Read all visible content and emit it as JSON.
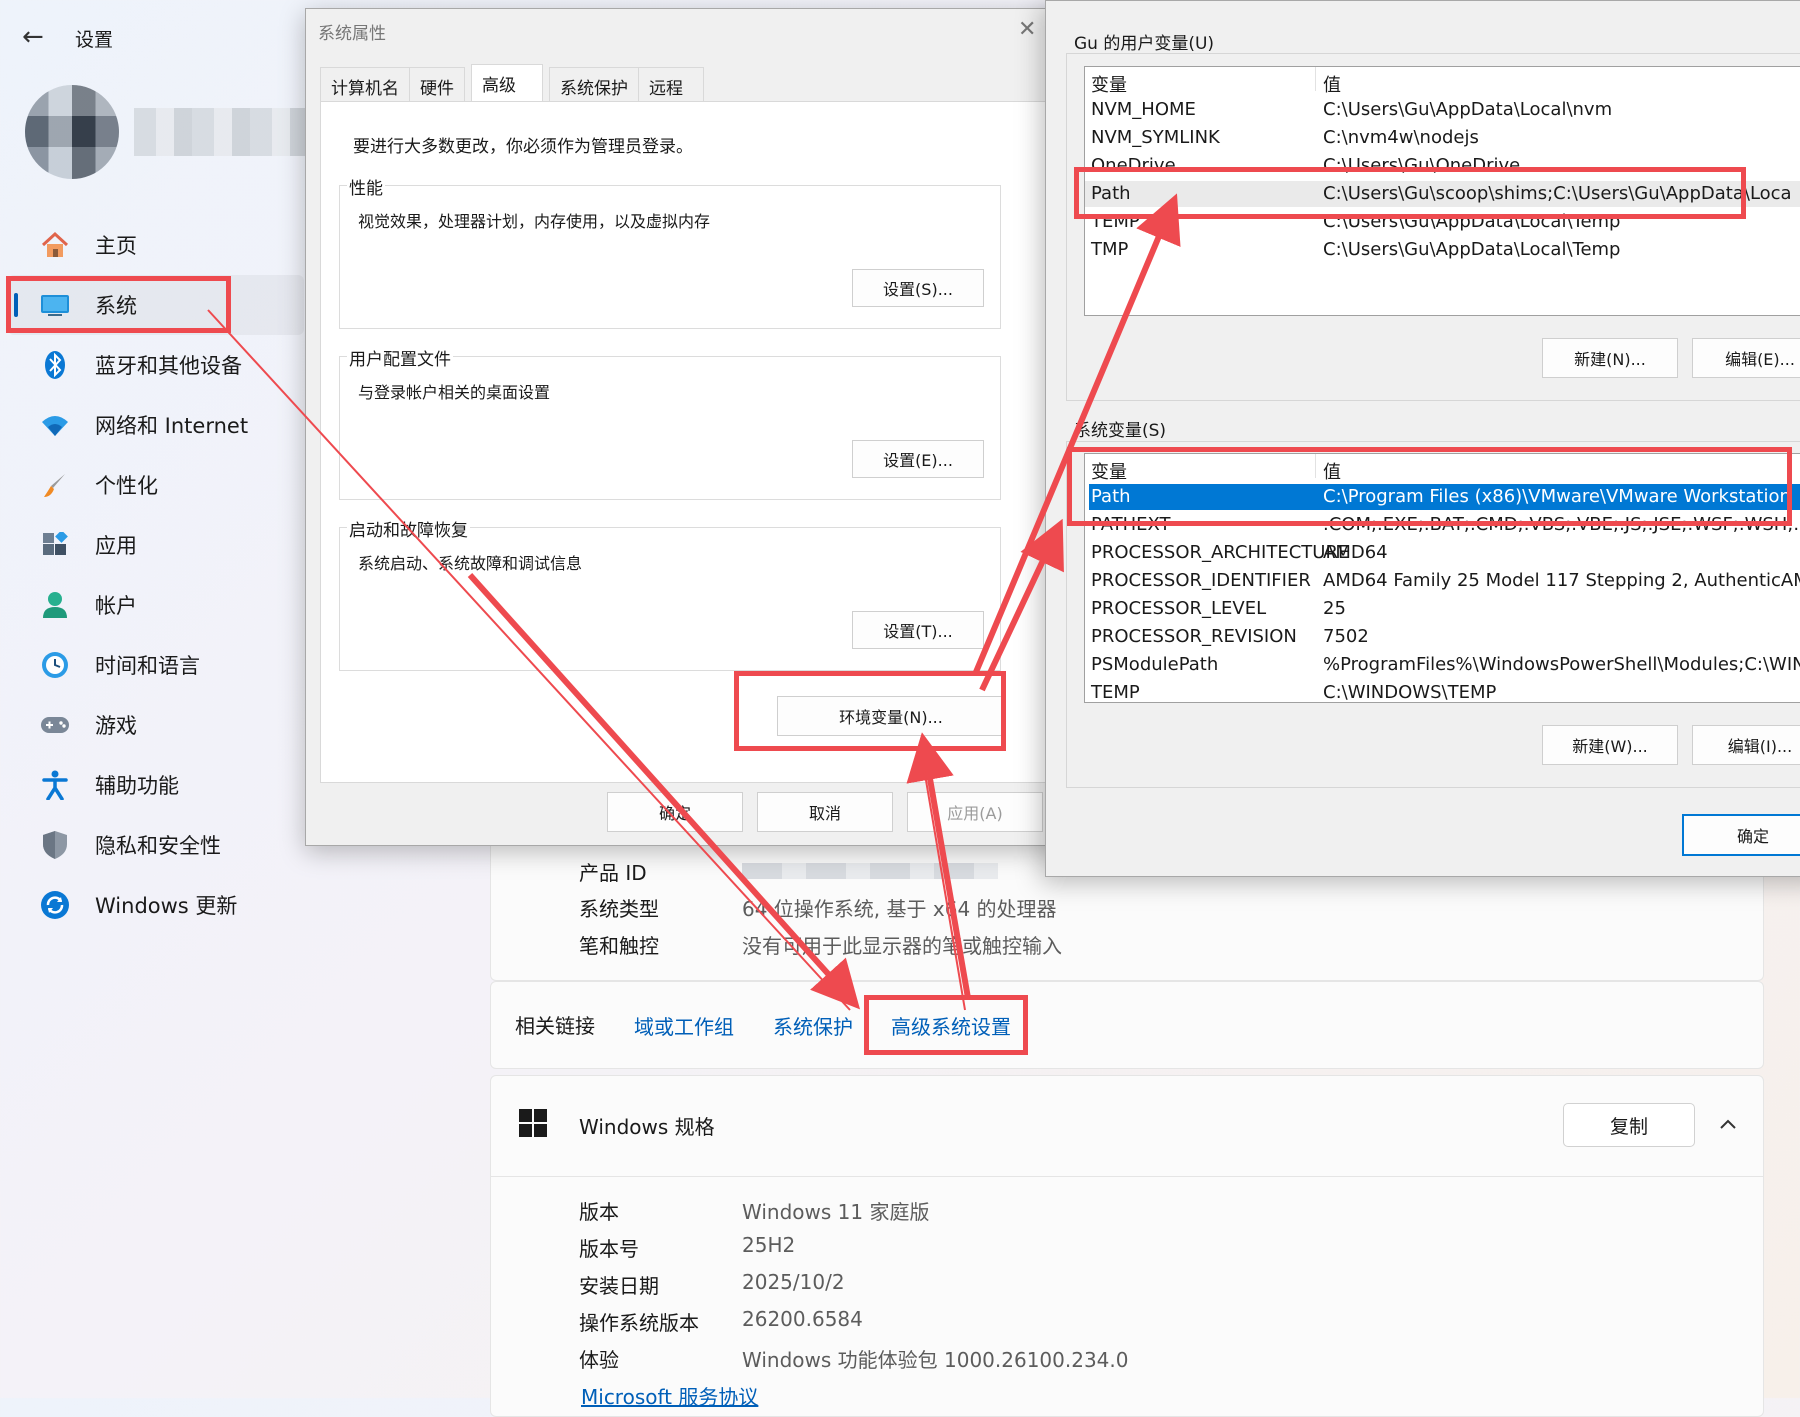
{
  "settings": {
    "title": "设置",
    "nav": [
      {
        "label": "主页",
        "icon": "home-icon"
      },
      {
        "label": "系统",
        "icon": "system-icon",
        "active": true
      },
      {
        "label": "蓝牙和其他设备",
        "icon": "bluetooth-icon"
      },
      {
        "label": "网络和 Internet",
        "icon": "wifi-icon"
      },
      {
        "label": "个性化",
        "icon": "brush-icon"
      },
      {
        "label": "应用",
        "icon": "apps-icon"
      },
      {
        "label": "帐户",
        "icon": "account-icon"
      },
      {
        "label": "时间和语言",
        "icon": "clock-globe-icon"
      },
      {
        "label": "游戏",
        "icon": "gamepad-icon"
      },
      {
        "label": "辅助功能",
        "icon": "accessibility-icon"
      },
      {
        "label": "隐私和安全性",
        "icon": "shield-icon"
      },
      {
        "label": "Windows 更新",
        "icon": "update-icon"
      }
    ],
    "device_specs": [
      {
        "key": "产品 ID",
        "value": ""
      },
      {
        "key": "系统类型",
        "value": "64 位操作系统, 基于 x64 的处理器"
      },
      {
        "key": "笔和触控",
        "value": "没有可用于此显示器的笔或触控输入"
      }
    ],
    "related": {
      "label": "相关链接",
      "links": [
        "域或工作组",
        "系统保护",
        "高级系统设置"
      ]
    },
    "windows_specs": {
      "title": "Windows 规格",
      "copy": "复制",
      "rows": [
        {
          "key": "版本",
          "value": "Windows 11 家庭版"
        },
        {
          "key": "版本号",
          "value": "25H2"
        },
        {
          "key": "安装日期",
          "value": "2025/10/2"
        },
        {
          "key": "操作系统版本",
          "value": "26200.6584"
        },
        {
          "key": "体验",
          "value": "Windows 功能体验包 1000.26100.234.0"
        }
      ],
      "link": "Microsoft 服务协议"
    }
  },
  "sysprops": {
    "title": "系统属性",
    "tabs": [
      "计算机名",
      "硬件",
      "高级",
      "系统保护",
      "远程"
    ],
    "notice": "要进行大多数更改，你必须作为管理员登录。",
    "groups": [
      {
        "title": "性能",
        "desc": "视觉效果，处理器计划，内存使用，以及虚拟内存",
        "button": "设置(S)..."
      },
      {
        "title": "用户配置文件",
        "desc": "与登录帐户相关的桌面设置",
        "button": "设置(E)..."
      },
      {
        "title": "启动和故障恢复",
        "desc": "系统启动、系统故障和调试信息",
        "button": "设置(T)..."
      }
    ],
    "env_button": "环境变量(N)...",
    "ok": "确定",
    "cancel": "取消",
    "apply": "应用(A)"
  },
  "envvars": {
    "user_title": "Gu 的用户变量(U)",
    "col_var": "变量",
    "col_val": "值",
    "user_vars": [
      {
        "name": "NVM_HOME",
        "value": "C:\\Users\\Gu\\AppData\\Local\\nvm"
      },
      {
        "name": "NVM_SYMLINK",
        "value": "C:\\nvm4w\\nodejs"
      },
      {
        "name": "OneDrive",
        "value": "C:\\Users\\Gu\\OneDrive"
      },
      {
        "name": "Path",
        "value": "C:\\Users\\Gu\\scoop\\shims;C:\\Users\\Gu\\AppData\\Loca"
      },
      {
        "name": "TEMP",
        "value": "C:\\Users\\Gu\\AppData\\Local\\Temp"
      },
      {
        "name": "TMP",
        "value": "C:\\Users\\Gu\\AppData\\Local\\Temp"
      }
    ],
    "user_new": "新建(N)...",
    "user_edit": "编辑(E)...",
    "sys_title": "系统变量(S)",
    "sys_vars": [
      {
        "name": "Path",
        "value": "C:\\Program Files (x86)\\VMware\\VMware Workstation"
      },
      {
        "name": "PATHEXT",
        "value": ".COM;.EXE;.BAT;.CMD;.VBS;.VBE;.JS;.JSE;.WSF;.WSH;.MSC"
      },
      {
        "name": "PROCESSOR_ARCHITECTURE",
        "value": "AMD64"
      },
      {
        "name": "PROCESSOR_IDENTIFIER",
        "value": "AMD64 Family 25 Model 117 Stepping 2, AuthenticAMD"
      },
      {
        "name": "PROCESSOR_LEVEL",
        "value": "25"
      },
      {
        "name": "PROCESSOR_REVISION",
        "value": "7502"
      },
      {
        "name": "PSModulePath",
        "value": "%ProgramFiles%\\WindowsPowerShell\\Modules;C:\\WIN"
      },
      {
        "name": "TEMP",
        "value": "C:\\WINDOWS\\TEMP"
      }
    ],
    "sys_new": "新建(W)...",
    "sys_edit": "编辑(I)...",
    "ok": "确定"
  },
  "colors": {
    "annotation": "#ee4a4f",
    "accent": "#005fb8",
    "selection": "#0078d4"
  }
}
